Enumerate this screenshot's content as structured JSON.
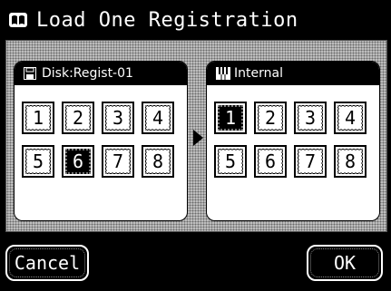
{
  "title": "Load One Registration",
  "left_panel": {
    "header": "Disk:Regist-01",
    "icon": "floppy-disk-icon",
    "slots": [
      {
        "label": "1",
        "selected": false
      },
      {
        "label": "2",
        "selected": false
      },
      {
        "label": "3",
        "selected": false
      },
      {
        "label": "4",
        "selected": false
      },
      {
        "label": "5",
        "selected": false
      },
      {
        "label": "6",
        "selected": true
      },
      {
        "label": "7",
        "selected": false
      },
      {
        "label": "8",
        "selected": false
      }
    ]
  },
  "right_panel": {
    "header": "Internal",
    "icon": "piano-keys-icon",
    "slots": [
      {
        "label": "1",
        "selected": true
      },
      {
        "label": "2",
        "selected": false
      },
      {
        "label": "3",
        "selected": false
      },
      {
        "label": "4",
        "selected": false
      },
      {
        "label": "5",
        "selected": false
      },
      {
        "label": "6",
        "selected": false
      },
      {
        "label": "7",
        "selected": false
      },
      {
        "label": "8",
        "selected": false
      }
    ]
  },
  "buttons": {
    "cancel": "Cancel",
    "ok": "OK"
  }
}
